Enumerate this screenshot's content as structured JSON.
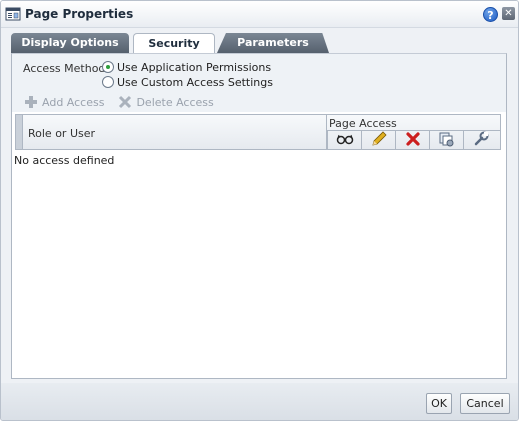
{
  "dialog": {
    "title": "Page Properties",
    "help_icon": "help-icon",
    "close_icon": "close-icon"
  },
  "tabs": [
    {
      "label": "Display Options",
      "active": false
    },
    {
      "label": "Security",
      "active": true
    },
    {
      "label": "Parameters",
      "active": false
    }
  ],
  "security": {
    "access_method_label": "Access Method",
    "options": [
      {
        "label": "Use Application Permissions",
        "checked": true
      },
      {
        "label": "Use Custom Access Settings",
        "checked": false
      }
    ],
    "toolbar": {
      "add_label": "Add Access",
      "delete_label": "Delete Access"
    },
    "table": {
      "role_header": "Role or User",
      "page_access_header": "Page Access",
      "permission_icons": [
        "view-icon",
        "edit-icon",
        "delete-icon",
        "personalize-icon",
        "manage-icon"
      ],
      "empty_text": "No access defined"
    }
  },
  "footer": {
    "ok_label": "OK",
    "cancel_label": "Cancel"
  },
  "colors": {
    "accent": "#1d5cc4",
    "tab_inactive": "#5f6a77",
    "radio_selected": "#2e9e3d",
    "delete_red": "#cc1f1f",
    "edit_yellow": "#e0b020"
  }
}
